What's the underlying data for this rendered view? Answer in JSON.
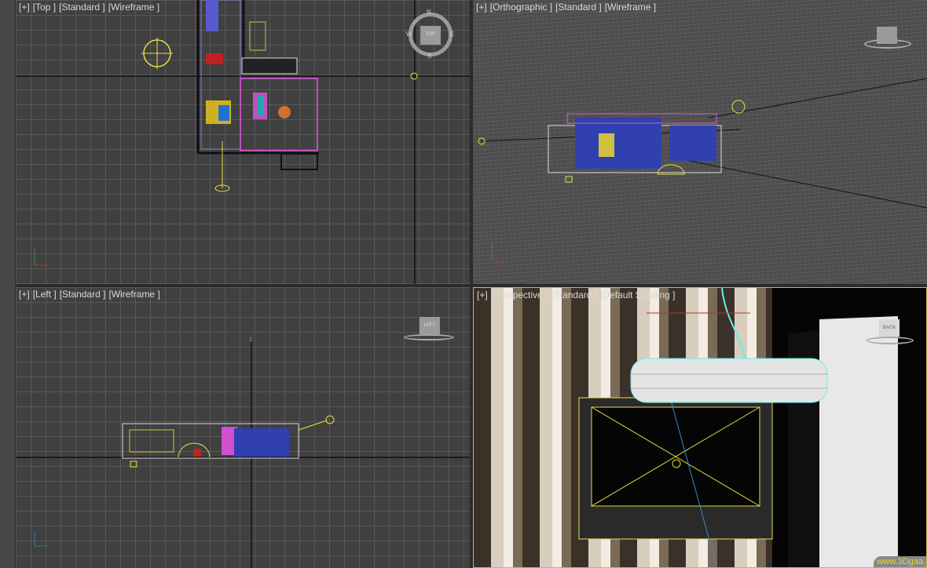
{
  "viewports": {
    "top": {
      "labels": [
        "[+]",
        "[Top ]",
        "[Standard ]",
        "[Wireframe ]"
      ],
      "viewcube": "TOP",
      "compass": {
        "n": "N",
        "s": "S",
        "e": "E",
        "w": "W"
      }
    },
    "orthographic": {
      "labels": [
        "[+]",
        "[Orthographic ]",
        "[Standard ]",
        "[Wireframe ]"
      ]
    },
    "left": {
      "labels": [
        "[+]",
        "[Left ]",
        "[Standard ]",
        "[Wireframe ]"
      ],
      "viewcube": "LEFT",
      "axis_z": "z"
    },
    "perspective": {
      "labels": [
        "[+]",
        "[Perspective ]",
        "[Standard ]",
        "[Default Shading ]"
      ],
      "viewcube": "BACK"
    }
  },
  "watermark": "www.3Dgaa"
}
